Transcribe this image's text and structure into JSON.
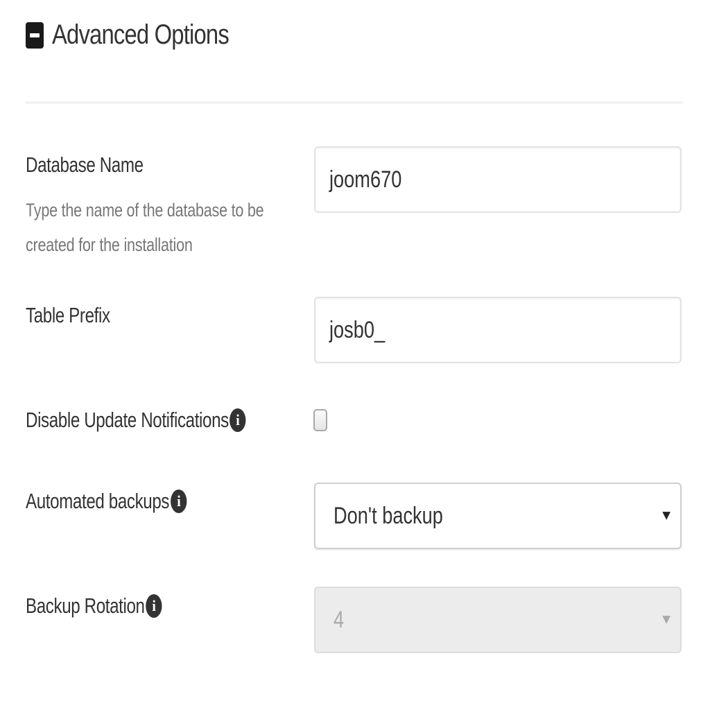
{
  "section": {
    "title": "Advanced Options",
    "toggle_icon": "minus-square-icon"
  },
  "fields": {
    "database_name": {
      "label": "Database Name",
      "help_line1": "Type the name of the database to be",
      "help_line2": "created for the installation",
      "value": "joom670"
    },
    "table_prefix": {
      "label": "Table Prefix",
      "value": "josb0_"
    },
    "disable_update_notifications": {
      "label": "Disable Update Notifications",
      "info_icon": "info-circle-icon",
      "checked": false
    },
    "automated_backups": {
      "label": "Automated backups",
      "info_icon": "info-circle-icon",
      "selected": "Don't backup",
      "arrow": "▼"
    },
    "backup_rotation": {
      "label": "Backup Rotation",
      "info_icon": "info-circle-icon",
      "selected": "4",
      "arrow": "▼",
      "disabled": true
    }
  }
}
